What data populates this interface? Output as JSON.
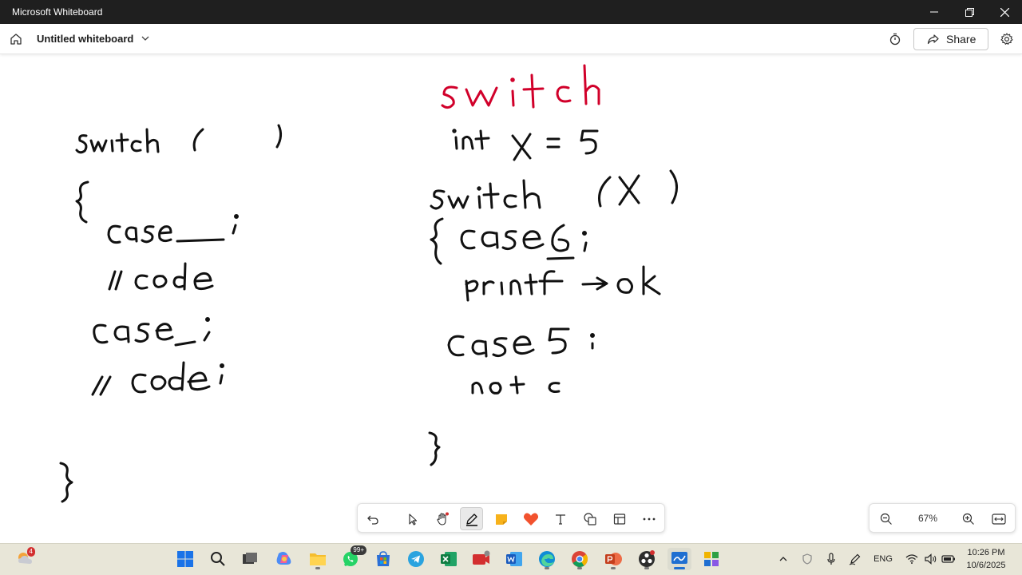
{
  "window": {
    "title": "Microsoft Whiteboard"
  },
  "header": {
    "board_title": "Untitled whiteboard",
    "share_label": "Share"
  },
  "canvas": {
    "left_notes": [
      "switch(   )",
      "{",
      "case_:",
      "//code",
      "case_:",
      "//code:",
      "}"
    ],
    "right_notes": [
      "switch",
      "int x = 5",
      "switch(X)",
      "{ case6:",
      "printf -> ok",
      "case5:",
      "not c",
      "}"
    ],
    "ink_colors": {
      "title_red": "#d1002a",
      "ink": "#111111"
    }
  },
  "toolbar": {
    "tools": [
      "undo-icon",
      "select-icon",
      "pan-icon",
      "pen-icon",
      "sticky-note-icon",
      "reactions-icon",
      "text-icon",
      "shapes-icon",
      "templates-icon",
      "more-icon"
    ]
  },
  "zoom": {
    "level": "67%"
  },
  "taskbar": {
    "weather_badge": "4",
    "whatsapp_badge": "99+",
    "language": "ENG",
    "time": "10:26 PM",
    "date": "10/6/2025"
  }
}
